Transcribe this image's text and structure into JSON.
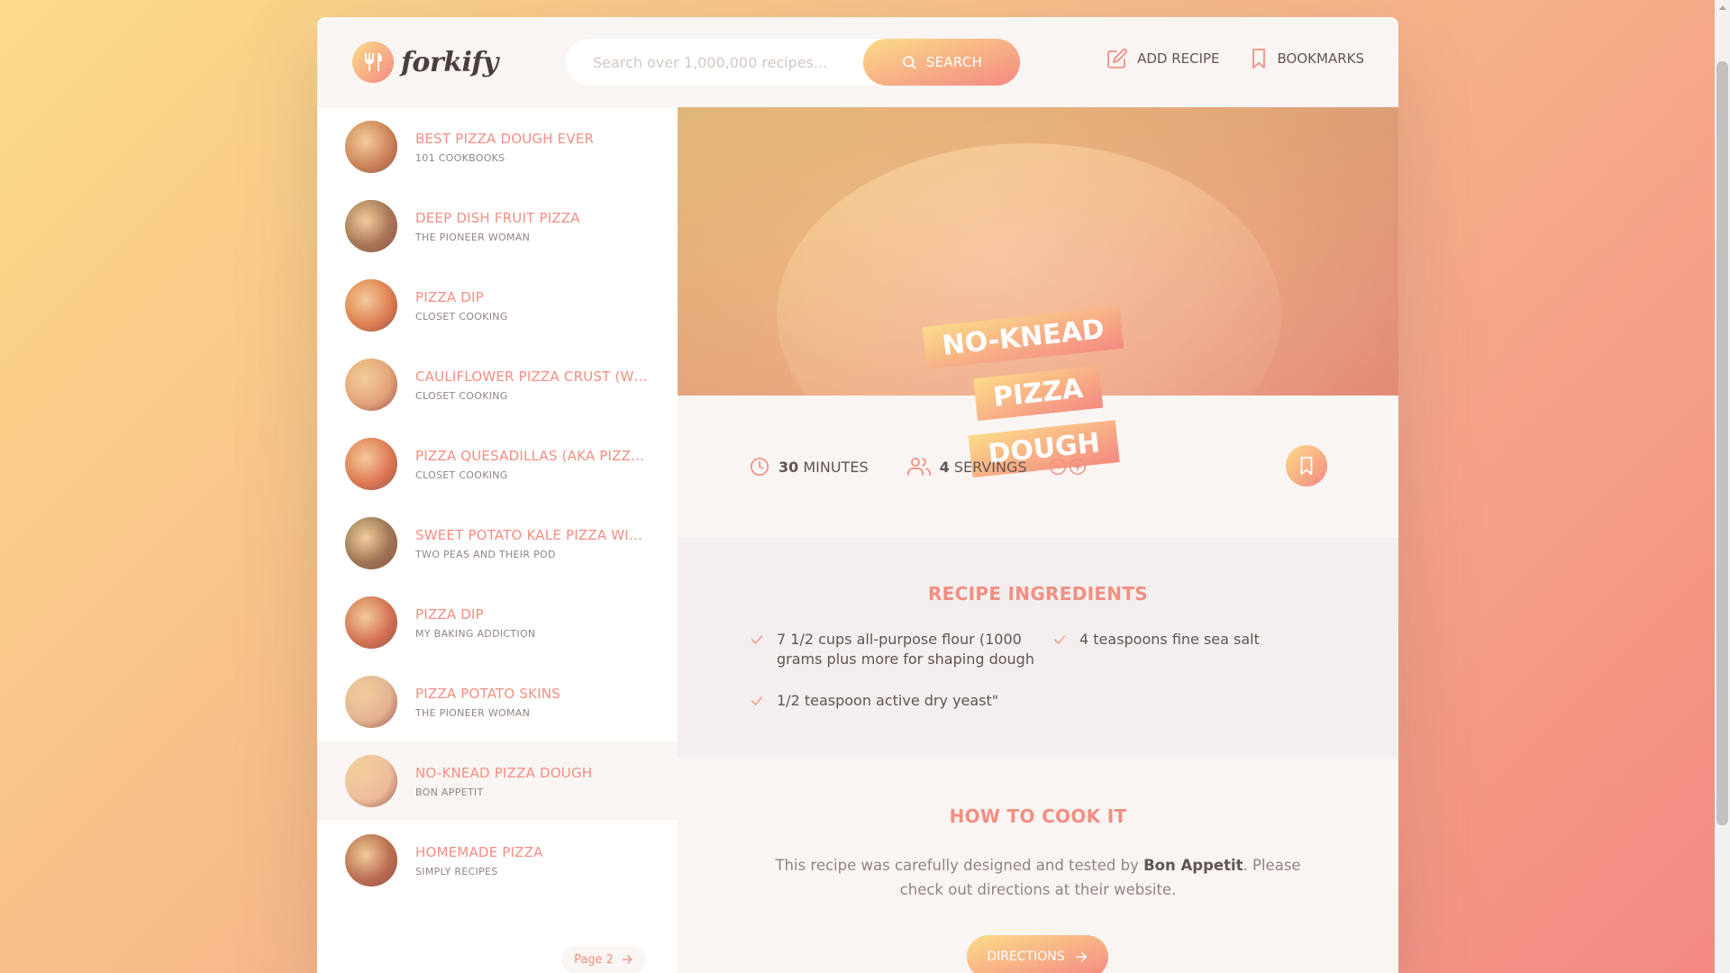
{
  "brand": {
    "name": "forkify"
  },
  "search": {
    "placeholder": "Search over 1,000,000 recipes...",
    "value": "",
    "button_label": "Search",
    "icon": "search-icon"
  },
  "nav": {
    "add_recipe_label": "Add recipe",
    "add_recipe_icon": "edit-icon",
    "bookmarks_label": "Bookmarks",
    "bookmarks_icon": "bookmark-icon"
  },
  "results": [
    {
      "title": "Best Pizza Dough Ever",
      "publisher": "101 Cookbooks",
      "active": false,
      "thumb_color": "#b86f42"
    },
    {
      "title": "Deep Dish Fruit Pizza",
      "publisher": "The Pioneer Woman",
      "active": false,
      "thumb_color": "#7e5a3e"
    },
    {
      "title": "Pizza Dip",
      "publisher": "Closet Cooking",
      "active": false,
      "thumb_color": "#d26a35"
    },
    {
      "title": "Cauliflower Pizza Crust (wit...",
      "publisher": "Closet Cooking",
      "active": false,
      "thumb_color": "#d9a072"
    },
    {
      "title": "Pizza Quesadillas (Aka Pizzad...",
      "publisher": "Closet Cooking",
      "active": false,
      "thumb_color": "#d25e3a"
    },
    {
      "title": "Sweet Potato Kale Pizza with...",
      "publisher": "Two Peas and Their Pod",
      "active": false,
      "thumb_color": "#6f5a3a"
    },
    {
      "title": "Pizza Dip",
      "publisher": "My Baking Addiction",
      "active": false,
      "thumb_color": "#c2563a"
    },
    {
      "title": "Pizza Potato Skins",
      "publisher": "The Pioneer Woman",
      "active": false,
      "thumb_color": "#d8b89a"
    },
    {
      "title": "No-Knead Pizza Dough",
      "publisher": "Bon Appetit",
      "active": true,
      "thumb_color": "#e8c8a8"
    },
    {
      "title": "Homemade Pizza",
      "publisher": "Simply Recipes",
      "active": false,
      "thumb_color": "#9a4e34"
    }
  ],
  "pagination": {
    "next_label": "Page 2"
  },
  "recipe": {
    "title_line1": "No-Knead Pizza",
    "title_line2": "Dough",
    "cooking_time": "30",
    "cooking_time_unit": "minutes",
    "servings": "4",
    "servings_unit": "servings",
    "ingredients_heading": "Recipe ingredients",
    "ingredients": [
      "7 1/2 cups all-purpose flour (1000 grams plus more for shaping dough",
      "4 teaspoons fine sea salt",
      "1/2 teaspoon active dry yeast\""
    ],
    "cook_heading": "How to cook it",
    "cook_text_before": "This recipe was carefully designed and tested by ",
    "cook_publisher": "Bon Appetit",
    "cook_text_after": ". Please check out directions at their website.",
    "directions_label": "Directions"
  },
  "colors": {
    "accent": "#f38e82",
    "gradient_start": "#fbdb89",
    "gradient_end": "#f48982",
    "text": "#615551",
    "panel": "#f9f5f3"
  }
}
